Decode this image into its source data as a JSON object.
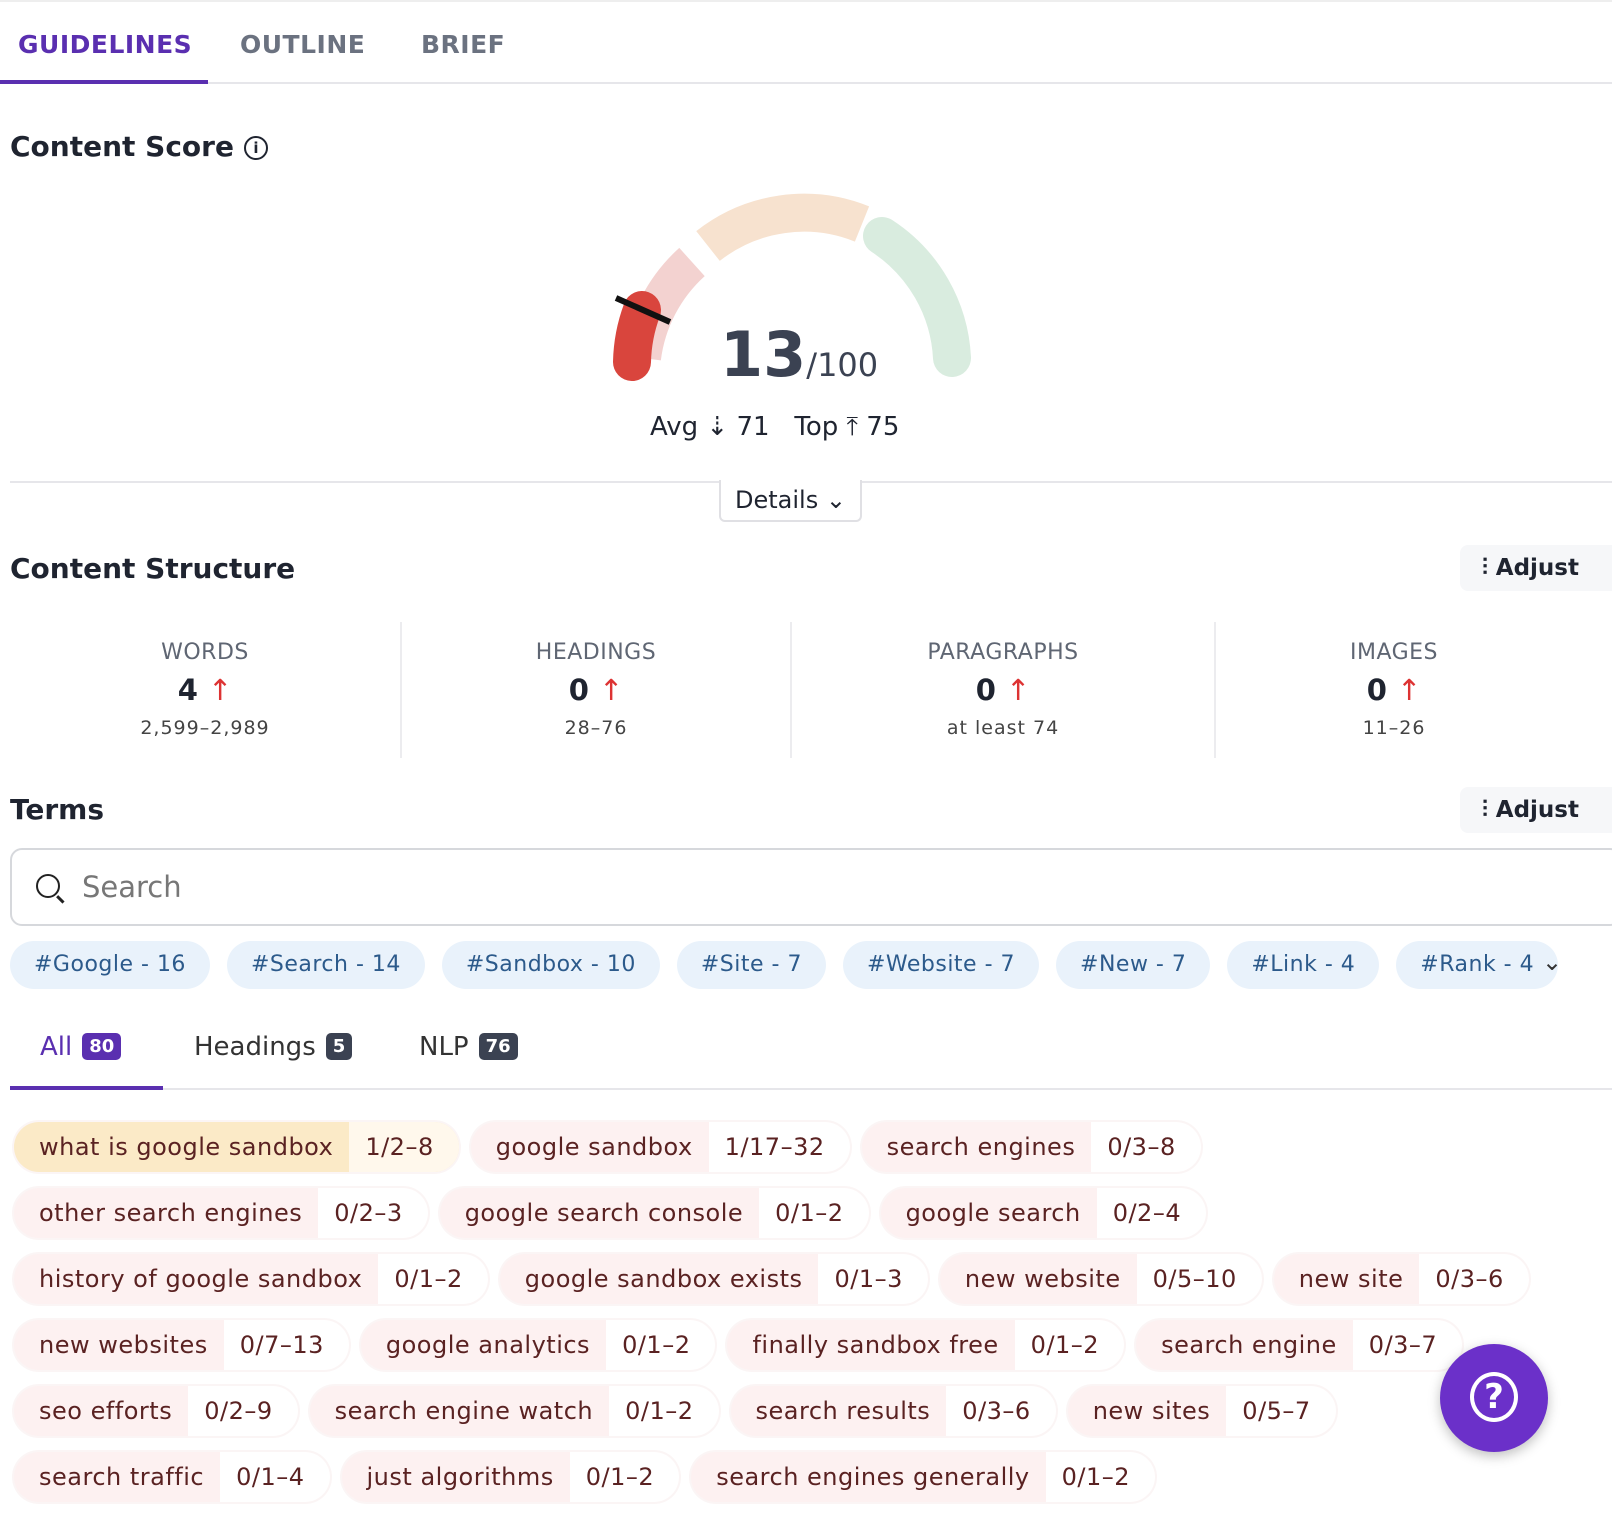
{
  "tabs": [
    {
      "label": "GUIDELINES",
      "active": true
    },
    {
      "label": "OUTLINE"
    },
    {
      "label": "BRIEF"
    }
  ],
  "content_score": {
    "title": "Content Score",
    "info_icon": "info-icon",
    "score": "13",
    "max": "/100",
    "value": 13,
    "avg_label": "Avg",
    "avg": "71",
    "top_label": "Top",
    "top": "75",
    "details_label": "Details",
    "colors": {
      "low": "#d9453d",
      "low_track": "#f3d2d0",
      "mid_track": "#f7e2cf",
      "high_track": "#d9ecdf",
      "accent": "#5a2fb0"
    }
  },
  "structure": {
    "title": "Content Structure",
    "adjust_label": "Adjust",
    "stats": [
      {
        "label": "WORDS",
        "value": "4",
        "range": "2,599–2,989"
      },
      {
        "label": "HEADINGS",
        "value": "0",
        "range": "28–76"
      },
      {
        "label": "PARAGRAPHS",
        "value": "0",
        "range": "at least 74"
      },
      {
        "label": "IMAGES",
        "value": "0",
        "range": "11–26"
      }
    ]
  },
  "terms": {
    "title": "Terms",
    "adjust_label": "Adjust",
    "search_placeholder": "Search",
    "tags": [
      "#Google - 16",
      "#Search - 14",
      "#Sandbox - 10",
      "#Site - 7",
      "#Website - 7",
      "#New - 7",
      "#Link - 4",
      "#Rank - 4"
    ],
    "subtabs": [
      {
        "label": "All",
        "count": "80"
      },
      {
        "label": "Headings",
        "count": "5"
      },
      {
        "label": "NLP",
        "count": "76"
      }
    ],
    "items": [
      {
        "term": "what is google sandbox",
        "count": "1/2–8",
        "highlight": true
      },
      {
        "term": "google sandbox",
        "count": "1/17–32"
      },
      {
        "term": "search engines",
        "count": "0/3–8"
      },
      {
        "term": "other search engines",
        "count": "0/2–3"
      },
      {
        "term": "google search console",
        "count": "0/1–2"
      },
      {
        "term": "google search",
        "count": "0/2–4"
      },
      {
        "term": "history of google sandbox",
        "count": "0/1–2"
      },
      {
        "term": "google sandbox exists",
        "count": "0/1–3"
      },
      {
        "term": "new website",
        "count": "0/5–10"
      },
      {
        "term": "new site",
        "count": "0/3–6"
      },
      {
        "term": "new websites",
        "count": "0/7–13"
      },
      {
        "term": "google analytics",
        "count": "0/1–2"
      },
      {
        "term": "finally sandbox free",
        "count": "0/1–2"
      },
      {
        "term": "search engine",
        "count": "0/3–7"
      },
      {
        "term": "seo efforts",
        "count": "0/2–9"
      },
      {
        "term": "search engine watch",
        "count": "0/1–2"
      },
      {
        "term": "search results",
        "count": "0/3–6"
      },
      {
        "term": "new sites",
        "count": "0/5–7"
      },
      {
        "term": "search traffic",
        "count": "0/1–4"
      },
      {
        "term": "just algorithms",
        "count": "0/1–2"
      },
      {
        "term": "search engines generally",
        "count": "0/1–2"
      }
    ]
  },
  "help": {
    "label": "?"
  }
}
